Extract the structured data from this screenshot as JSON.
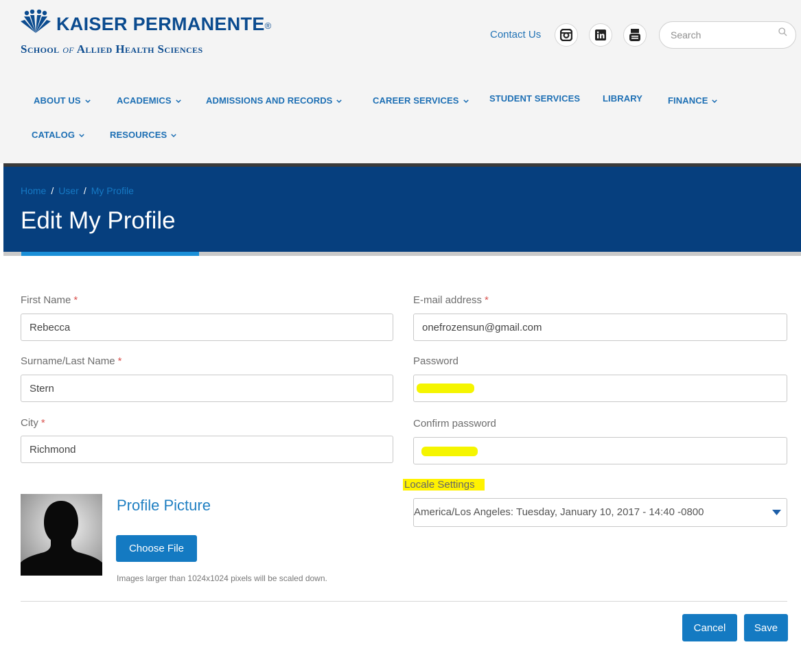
{
  "logo": {
    "title": "KAISER PERMANENTE",
    "reg": "®",
    "subtitle_a": "School ",
    "subtitle_of": "of",
    "subtitle_b": " Allied Health Sciences"
  },
  "header": {
    "contact": "Contact Us",
    "social": [
      "instagram-icon",
      "linkedin-icon",
      "youtube-icon"
    ],
    "search_placeholder": "Search"
  },
  "nav": {
    "items": [
      {
        "label": "ABOUT US",
        "dropdown": true
      },
      {
        "label": "ACADEMICS",
        "dropdown": true
      },
      {
        "label": "ADMISSIONS AND RECORDS",
        "dropdown": true
      },
      {
        "label": "CAREER SERVICES",
        "dropdown": true
      },
      {
        "label": "STUDENT SERVICES",
        "dropdown": false
      },
      {
        "label": "LIBRARY",
        "dropdown": false
      },
      {
        "label": "FINANCE",
        "dropdown": true
      },
      {
        "label": "CATALOG",
        "dropdown": true
      },
      {
        "label": "RESOURCES",
        "dropdown": true
      }
    ]
  },
  "breadcrumb": {
    "home": "Home",
    "sep": "/",
    "user": "User",
    "current": "My Profile"
  },
  "page_title": "Edit My Profile",
  "form": {
    "first_name_label": "First Name",
    "first_name_value": "Rebecca",
    "last_name_label": "Surname/Last Name",
    "last_name_value": "Stern",
    "city_label": "City",
    "city_value": "Richmond",
    "email_label": "E-mail address",
    "email_value": "onefrozensun@gmail.com",
    "password_label": "Password",
    "confirm_label": "Confirm password",
    "locale_label": "Locale Settings",
    "locale_value": "America/Los Angeles: Tuesday, January 10, 2017 - 14:40 -0800",
    "required_mark": "*"
  },
  "profile": {
    "title": "Profile Picture",
    "choose_file": "Choose File",
    "hint": "Images larger than 1024x1024 pixels will be scaled down."
  },
  "actions": {
    "cancel": "Cancel",
    "save": "Save"
  },
  "colors": {
    "brand_blue": "#0b4b8f",
    "banner": "#063f7e",
    "button": "#147ac2",
    "highlight": "#fff200"
  }
}
